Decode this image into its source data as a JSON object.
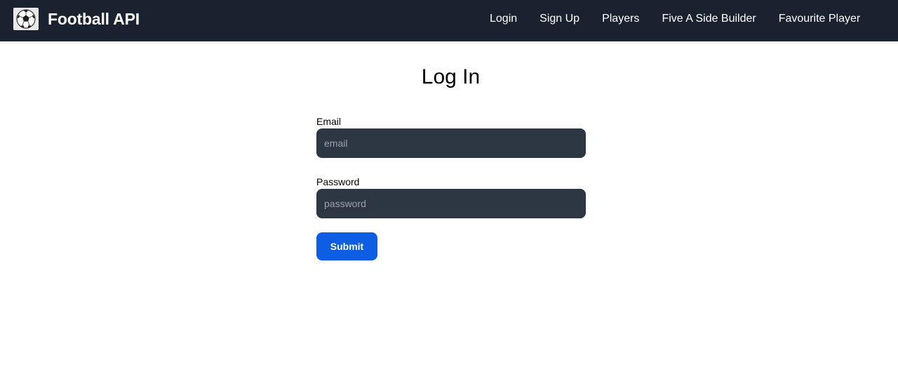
{
  "brand": {
    "logo_icon": "soccer-ball-icon",
    "title": "Football API"
  },
  "nav": {
    "items": [
      {
        "label": "Login"
      },
      {
        "label": "Sign Up"
      },
      {
        "label": "Players"
      },
      {
        "label": "Five A Side Builder"
      },
      {
        "label": "Favourite Player"
      }
    ]
  },
  "page": {
    "title": "Log In"
  },
  "form": {
    "email": {
      "label": "Email",
      "placeholder": "email",
      "value": ""
    },
    "password": {
      "label": "Password",
      "placeholder": "password",
      "value": ""
    },
    "submit_label": "Submit"
  },
  "colors": {
    "navbar_bg": "#1a222f",
    "input_bg": "#2d3643",
    "accent": "#0d5ee2"
  }
}
